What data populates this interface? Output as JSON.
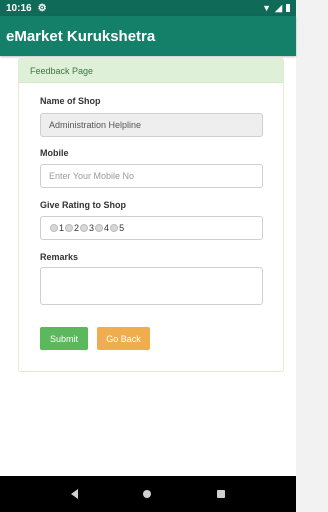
{
  "status_bar": {
    "time": "10:16",
    "settings_icon": "gear-icon",
    "wifi_icon": "wifi-icon",
    "signal_icon": "signal-icon",
    "battery_icon": "battery-icon"
  },
  "app_bar": {
    "title": "eMarket Kurukshetra"
  },
  "card": {
    "header": "Feedback Page",
    "shop_label": "Name of  Shop",
    "shop_value": "Administration Helpline",
    "mobile_label": "Mobile",
    "mobile_placeholder": "Enter Your Mobile No",
    "rating_label": "Give Rating to Shop",
    "rating_options": [
      "1",
      "2",
      "3",
      "4",
      "5"
    ],
    "remarks_label": "Remarks",
    "remarks_value": "",
    "submit_label": "Submit",
    "back_label": "Go Back"
  },
  "colors": {
    "status_bar": "#0f6b58",
    "app_bar": "#15806a",
    "card_header_bg": "#dff0d8",
    "submit_button": "#5cb85c",
    "back_button": "#f0ad4e"
  },
  "nav_bar": {
    "back_icon": "nav-back-icon",
    "home_icon": "nav-home-icon",
    "recent_icon": "nav-recent-apps-icon"
  }
}
